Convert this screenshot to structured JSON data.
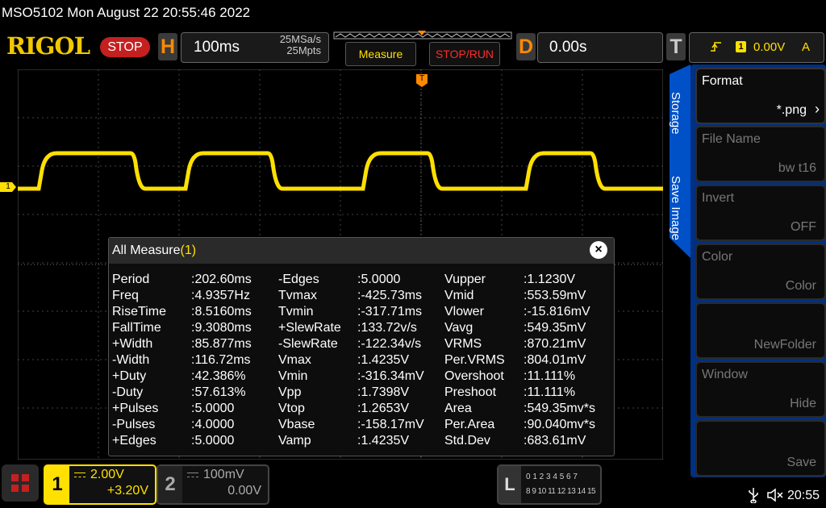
{
  "header": {
    "title": "MSO5102  Mon August 22 20:55:46 2022",
    "brand": "RIGOL",
    "run_state": "STOP",
    "horizontal": {
      "label": "H",
      "timebase": "100ms",
      "sample_rate": "25MSa/s",
      "memory_depth": "25Mpts"
    },
    "menu_buttons": {
      "measure": "Measure",
      "stop_run": "STOP/RUN"
    },
    "delay": {
      "label": "D",
      "value": "0.00s"
    },
    "trigger": {
      "label": "T",
      "channel": "1",
      "level": "0.00V",
      "coupling": "A"
    },
    "colors": {
      "ch1": "#ffe000",
      "stop": "#c42020",
      "accent": "#ff8a00",
      "panel_blue": "#0055cc"
    }
  },
  "waveform": {
    "channel_marker": "1",
    "trigger_marker": "T"
  },
  "side_menu": {
    "tab_storage": "Storage",
    "tab_save_image": "Save Image",
    "items": [
      {
        "label": "Format",
        "value": "*.png",
        "active": true
      },
      {
        "label": "File Name",
        "value": "bw t16",
        "active": false
      },
      {
        "label": "Invert",
        "value": "OFF",
        "active": false
      },
      {
        "label": "Color",
        "value": "Color",
        "active": false
      },
      {
        "label": "",
        "value": "NewFolder",
        "active": false
      },
      {
        "label": "Window",
        "value": "Hide",
        "active": false
      },
      {
        "label": "",
        "value": "Save",
        "active": false
      }
    ]
  },
  "measure_panel": {
    "title": "All Measure",
    "count": "(1)",
    "col1_names": [
      "Period",
      "Freq",
      "RiseTime",
      "FallTime",
      "+Width",
      "-Width",
      "+Duty",
      "-Duty",
      "+Pulses",
      "-Pulses",
      "+Edges"
    ],
    "col1_values": [
      ":202.60ms",
      ":4.9357Hz",
      ":8.5160ms",
      ":9.3080ms",
      ":85.877ms",
      ":116.72ms",
      ":42.386%",
      ":57.613%",
      ":5.0000",
      ":4.0000",
      ":5.0000"
    ],
    "col2_names": [
      "-Edges",
      "Tvmax",
      "Tvmin",
      "+SlewRate",
      "-SlewRate",
      "Vmax",
      "Vmin",
      "Vpp",
      "Vtop",
      "Vbase",
      "Vamp"
    ],
    "col2_values": [
      ":5.0000",
      ":-425.73ms",
      ":-317.71ms",
      ":133.72v/s",
      ":-122.34v/s",
      ":1.4235V",
      ":-316.34mV",
      ":1.7398V",
      ":1.2653V",
      ":-158.17mV",
      ":1.4235V"
    ],
    "col3_names": [
      "Vupper",
      "Vmid",
      "Vlower",
      "Vavg",
      "VRMS",
      "Per.VRMS",
      "Overshoot",
      "Preshoot",
      "Area",
      "Per.Area",
      "Std.Dev"
    ],
    "col3_values": [
      ":1.1230V",
      ":553.59mV",
      ":-15.816mV",
      ":549.35mV",
      ":870.21mV",
      ":804.01mV",
      ":11.111%",
      ":11.111%",
      ":549.35mv*s",
      ":90.040mv*s",
      ":683.61mV"
    ]
  },
  "bottom_bar": {
    "ch1": {
      "number": "1",
      "scale": "2.00V",
      "offset": "+3.20V"
    },
    "ch2": {
      "number": "2",
      "scale": "100mV",
      "offset": "0.00V"
    },
    "la": {
      "label": "L",
      "row1": "0 1 2 3  4 5 6 7",
      "row2": "8 9 10 11  12 13 14 15"
    },
    "time": "20:55"
  }
}
